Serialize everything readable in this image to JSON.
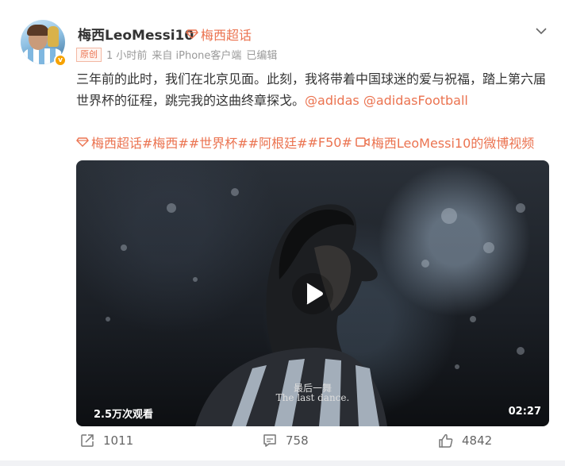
{
  "post": {
    "author": "梅西LeoMessi10",
    "supertopic": "梅西超话",
    "original_label": "原创",
    "time": "1 小时前",
    "source": "来自 iPhone客户端",
    "edited": "已编辑",
    "text_main": "三年前的此时，我们在北京见面。此刻，我将带着中国球迷的爱与祝福，踏上第六届世界杯的征程，跳完我的这曲终章探戈。",
    "mention_1": "@adidas",
    "mention_2": "@adidasFootball",
    "tags": {
      "t1": "梅西超话",
      "t2": "#梅西#",
      "t3": "#世界杯#",
      "t4": "#阿根廷#",
      "t5": "#F50#",
      "video_link": "梅西LeoMessi10的微博视频"
    }
  },
  "video": {
    "subtitle_cn": "最后一舞",
    "subtitle_en": "The last dance.",
    "views": "2.5万次观看",
    "duration": "02:27"
  },
  "actions": {
    "share_count": "1011",
    "comment_count": "758",
    "like_count": "4842"
  },
  "colors": {
    "accent": "#eb7350",
    "verified": "#f7a200"
  },
  "icons": {
    "share": "share-icon",
    "comment": "comment-icon",
    "like": "like-icon",
    "chevron": "chevron-down-icon",
    "supertopic": "diamond-icon",
    "video": "video-icon",
    "play": "play-icon"
  }
}
